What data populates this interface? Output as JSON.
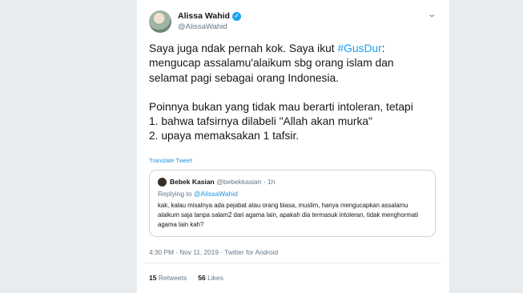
{
  "tweet": {
    "author_name": "Alissa Wahid",
    "author_handle": "@AlissaWahid",
    "verified_mark": "✓",
    "caret": "⌄",
    "line1_a": "Saya juga ndak pernah kok. Saya ikut ",
    "hashtag": "#GusDur",
    "line1_b": ":",
    "line2": "mengucap assalamu'alaikum sbg orang islam dan",
    "line3": "selamat pagi sebagai orang Indonesia.",
    "line4": "Poinnya bukan yang tidak mau berarti intoleran, tetapi",
    "line5": "1. bahwa tafsirnya dilabeli \"Allah akan murka\"",
    "line6": "2. upaya memaksakan 1 tafsir.",
    "translate_label": "Translate Tweet",
    "timestamp": "4:30 PM · Nov 11, 2019 · Twitter for Android",
    "retweets_count": "15",
    "retweets_label": "Retweets",
    "likes_count": "56",
    "likes_label": "Likes"
  },
  "quoted": {
    "author_name": "Bebek Kasian",
    "author_handle": "@bebekkasian · 1h",
    "replying_prefix": "Replying to ",
    "replying_to": "@AlissaWahid",
    "text": "kak, kalau misalnya ada pejabat atau orang biasa, muslim, hanya mengucapkan assalamu alaikum saja tanpa salam2 dari agama lain, apakah dia termasuk intoleran, tidak menghormati agama lain kah?"
  },
  "colors": {
    "link": "#1da1f2",
    "text": "#14171a",
    "muted": "#657786",
    "border": "#e6ecf0"
  }
}
